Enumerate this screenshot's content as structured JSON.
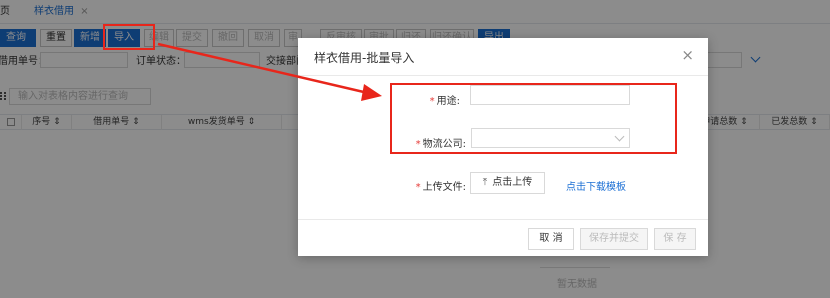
{
  "tabs": {
    "home_label": "页",
    "active_label": "样衣借用",
    "active_close": "×"
  },
  "toolbar": {
    "query": "查询",
    "reset": "重置",
    "add": "新增",
    "import": "导入",
    "edit": "编辑",
    "submit": "提交",
    "withdraw": "撤回",
    "cancel": "取消",
    "audit": "审核",
    "anti_audit": "反审核",
    "approve": "审批",
    "return": "归还",
    "return_confirm": "归还确认",
    "export": "导出"
  },
  "filters": {
    "borrow_no_label": "借用单号：",
    "order_status_label": "订单状态：",
    "handover_label": "交接部门"
  },
  "table": {
    "search_placeholder": "输入对表格内容进行查询",
    "columns": [
      "序号",
      "借用单号",
      "wms发货单号",
      "申请总数",
      "已发总数"
    ],
    "empty_text": "暂无数据"
  },
  "modal": {
    "title": "样衣借用-批量导入",
    "close": "×",
    "purpose_label": "用途:",
    "logistics_label": "物流公司:",
    "upload_label": "上传文件:",
    "upload_button": "点击上传",
    "download_link": "点击下载模板",
    "cancel_button": "取 消",
    "save_submit_button": "保存并提交",
    "save_button": "保 存"
  },
  "colors": {
    "primary": "#1b6fd4",
    "highlight": "#e8261b"
  }
}
